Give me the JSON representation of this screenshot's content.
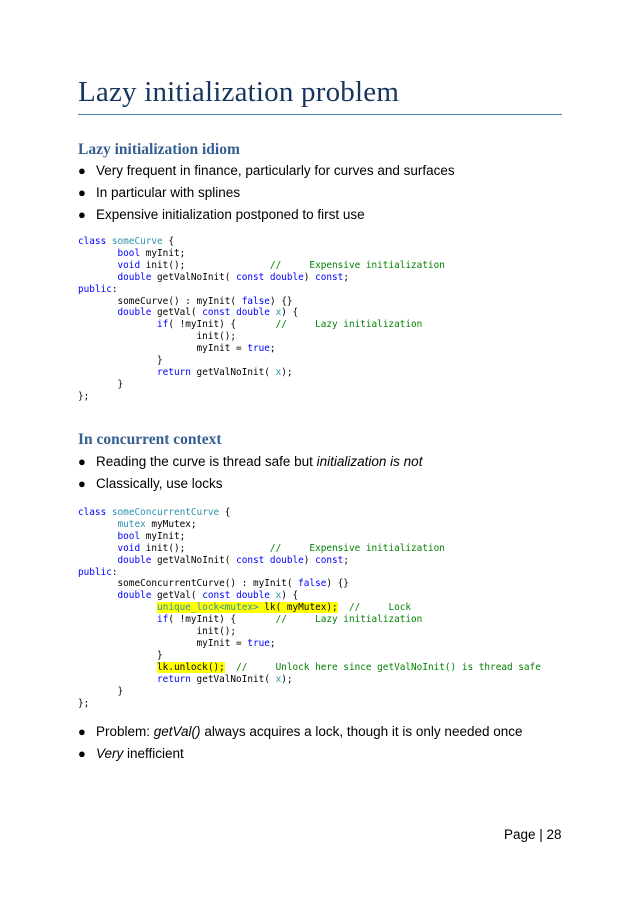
{
  "title": "Lazy initialization problem",
  "section1": {
    "heading": "Lazy initialization idiom",
    "bullets": [
      "Very frequent in finance, particularly for curves and surfaces",
      "In particular with splines",
      "Expensive initialization postponed to first use"
    ]
  },
  "code1": {
    "l1_kw": "class",
    "l1_ty": "someCurve",
    "l1_rest": " {",
    "l2_kw": "bool",
    "l2_rest": " myInit;",
    "l3_kw": "void",
    "l3_rest": " init();",
    "l3_cm": "//     Expensive initialization",
    "l4_kw": "double",
    "l4_a": " getValNoInit( ",
    "l4_kw2": "const double",
    "l4_b": ") ",
    "l4_kw3": "const",
    "l4_c": ";",
    "l5_kw": "public",
    "l5_rest": ":",
    "l6_a": "someCurve() : myInit( ",
    "l6_kw": "false",
    "l6_b": ") {}",
    "l7_kw": "double",
    "l7_a": " getVal( ",
    "l7_kw2": "const double",
    "l7_ty": " x",
    "l7_b": ") {",
    "l8_kw": "if",
    "l8_a": "( !myInit) {",
    "l8_cm": "//     Lazy initialization",
    "l9": "init();",
    "l10_a": "myInit = ",
    "l10_kw": "true",
    "l10_b": ";",
    "l11": "}",
    "l12_kw": "return",
    "l12_a": " getValNoInit( ",
    "l12_ty": "x",
    "l12_b": ");",
    "l13": "}",
    "l14": "};"
  },
  "section2": {
    "heading": "In concurrent context",
    "bullet1_a": "Reading the curve is thread safe but ",
    "bullet1_b": "initialization is not",
    "bullet2": "Classically, use locks"
  },
  "code2": {
    "l1_kw": "class",
    "l1_ty": "someConcurrentCurve",
    "l1_rest": " {",
    "l2_ty": "mutex",
    "l2_rest": " myMutex;",
    "l3_kw": "bool",
    "l3_rest": " myInit;",
    "l4_kw": "void",
    "l4_rest": " init();",
    "l4_cm": "//     Expensive initialization",
    "l5_kw": "double",
    "l5_a": " getValNoInit( ",
    "l5_kw2": "const double",
    "l5_b": ") ",
    "l5_kw3": "const",
    "l5_c": ";",
    "l6_kw": "public",
    "l6_rest": ":",
    "l7_a": "someConcurrentCurve() : myInit( ",
    "l7_kw": "false",
    "l7_b": ") {}",
    "l8_kw": "double",
    "l8_a": " getVal( ",
    "l8_kw2": "const double",
    "l8_ty": " x",
    "l8_b": ") {",
    "l9_ty": "unique_lock",
    "l9_ty2": "<mutex>",
    "l9_a": " lk( myMutex);",
    "l9_cm": "//     Lock",
    "l10_kw": "if",
    "l10_a": "( !myInit) {",
    "l10_cm": "//     Lazy initialization",
    "l11": "init();",
    "l12_a": "myInit = ",
    "l12_kw": "true",
    "l12_b": ";",
    "l13": "}",
    "l14_a": "lk.unlock();",
    "l14_cm": "//     Unlock here since getValNoInit() is thread safe",
    "l15_kw": "return",
    "l15_a": " getValNoInit( ",
    "l15_ty": "x",
    "l15_b": ");",
    "l16": "}",
    "l17": "};"
  },
  "section3": {
    "bullet1_a": "Problem: ",
    "bullet1_b": "getVal()",
    "bullet1_c": " always acquires a lock, though it is only needed once",
    "bullet2_a": "Very",
    "bullet2_b": " inefficient"
  },
  "footer": {
    "page_label": "Page | 28"
  },
  "colors": {
    "title": "#17365d",
    "heading": "#365f91",
    "rule": "#4f81bd",
    "keyword": "#0000ff",
    "comment": "#008000",
    "type": "#2b91af",
    "highlight": "#ffff00"
  },
  "icons": {
    "bullet": "bullet-dot-icon"
  }
}
